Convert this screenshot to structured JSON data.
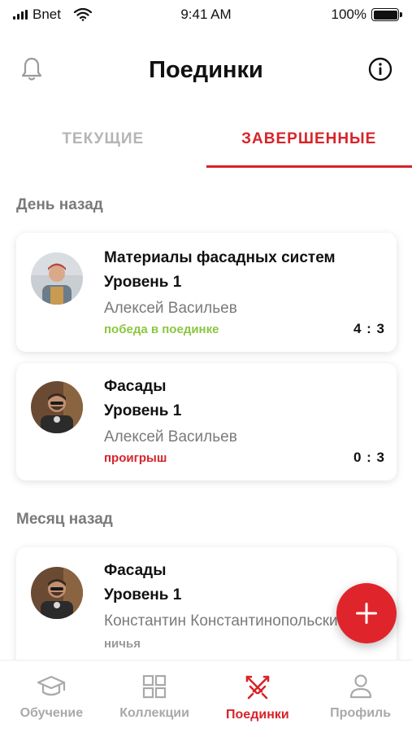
{
  "status_bar": {
    "carrier": "Bnet",
    "time": "9:41 AM",
    "battery": "100%"
  },
  "header": {
    "title": "Поединки"
  },
  "tabs": [
    {
      "label": "ТЕКУЩИЕ",
      "active": false
    },
    {
      "label": "ЗАВЕРШЕННЫЕ",
      "active": true
    }
  ],
  "sections": [
    {
      "label": "День назад"
    },
    {
      "label": "Месяц назад"
    }
  ],
  "duels": [
    {
      "topic": "Материалы фасадных систем",
      "level": "Уровень 1",
      "opponent": "Алексей Васильев",
      "result": "победа в поединке",
      "score": "4 : 3"
    },
    {
      "topic": "Фасады",
      "level": "Уровень 1",
      "opponent": "Алексей Васильев",
      "result": "проигрыш",
      "score": "0 : 3"
    },
    {
      "topic": "Фасады",
      "level": "Уровень 1",
      "opponent": "Константин Константинопольский",
      "result": "ничья",
      "score": ""
    }
  ],
  "bottom_nav": [
    {
      "label": "Обучение",
      "icon": "graduation-cap-icon"
    },
    {
      "label": "Коллекции",
      "icon": "grid-icon"
    },
    {
      "label": "Поединки",
      "icon": "crossed-swords-icon",
      "active": true
    },
    {
      "label": "Профиль",
      "icon": "person-icon"
    }
  ],
  "colors": {
    "accent": "#d8232a",
    "win": "#8cc63f",
    "muted": "#a9a9a9"
  }
}
